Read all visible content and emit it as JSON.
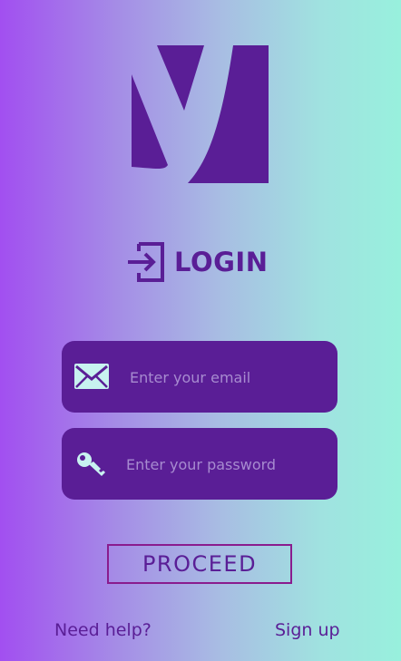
{
  "header": {
    "logo_icon": "y-logo-icon",
    "login_icon": "login-arrow-icon",
    "title": "LOGIN"
  },
  "form": {
    "email": {
      "icon": "envelope-icon",
      "value": "",
      "placeholder": "Enter your email"
    },
    "password": {
      "icon": "key-icon",
      "value": "",
      "placeholder": "Enter your password"
    },
    "submit_label": "PROCEED"
  },
  "footer": {
    "help_label": "Need help?",
    "signup_label": "Sign up"
  },
  "colors": {
    "primary": "#5a1e96",
    "accent_border": "#8a1b8e",
    "icon_fill": "#c8f2f0",
    "gradient_left": "#a24ff0",
    "gradient_right": "#98f0dd"
  }
}
